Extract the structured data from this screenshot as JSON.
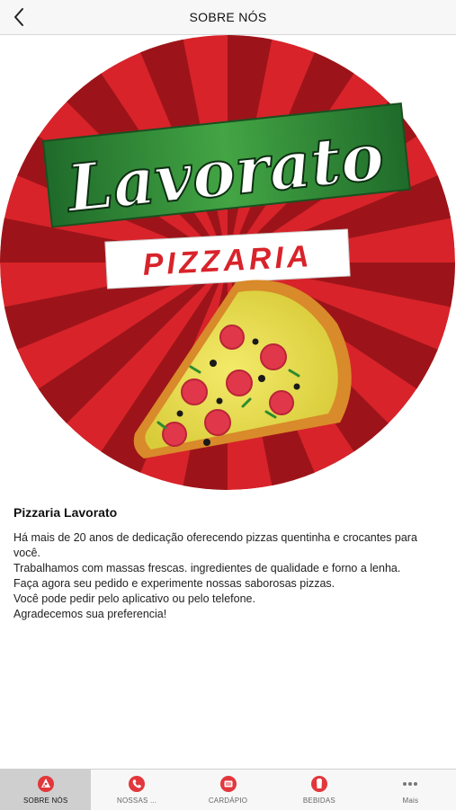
{
  "header": {
    "title": "SOBRE NÓS"
  },
  "logo": {
    "brand": "Lavorato",
    "subtitle": "PIZZARIA"
  },
  "content": {
    "title": "Pizzaria Lavorato",
    "paragraphs": [
      "Há mais de 20 anos de dedicação oferecendo pizzas quentinha e crocantes para você.",
      "Trabalhamos com massas frescas. ingredientes de qualidade e forno a lenha.",
      "Faça agora seu pedido e experimente nossas saborosas pizzas.",
      "Você pode pedir pelo aplicativo ou pelo telefone.",
      "Agradecemos sua preferencia!"
    ]
  },
  "tabs": [
    {
      "label": "SOBRE NÓS",
      "icon": "pizza-icon",
      "active": true
    },
    {
      "label": "NOSSAS ...",
      "icon": "phone-icon",
      "active": false
    },
    {
      "label": "CARDÁPIO",
      "icon": "menu-card-icon",
      "active": false
    },
    {
      "label": "BEBIDAS",
      "icon": "drink-icon",
      "active": false
    },
    {
      "label": "Mais",
      "icon": "more-icon",
      "active": false
    }
  ],
  "colors": {
    "accent": "#e2373b",
    "logo_red": "#d8232a",
    "logo_dark_red": "#9c1419",
    "banner_green": "#2f8a36"
  }
}
